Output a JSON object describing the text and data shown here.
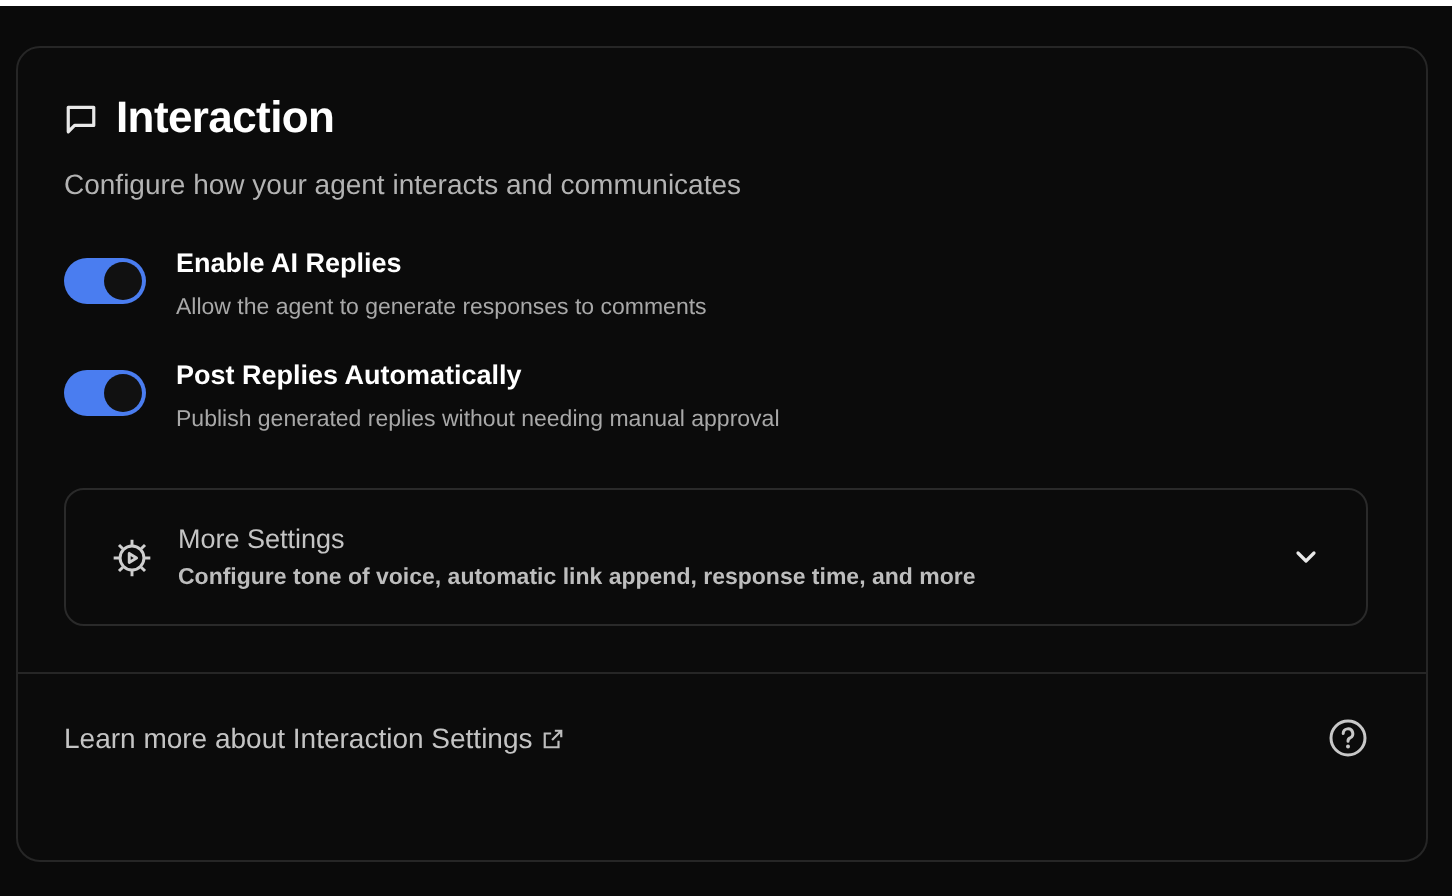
{
  "panel": {
    "title": "Interaction",
    "subtitle": "Configure how your agent interacts and communicates"
  },
  "toggles": [
    {
      "label": "Enable AI Replies",
      "description": "Allow the agent to generate responses to comments",
      "on": true
    },
    {
      "label": "Post Replies Automatically",
      "description": "Publish generated replies without needing manual approval",
      "on": true
    }
  ],
  "more_settings": {
    "title": "More Settings",
    "description": "Configure tone of voice, automatic link append, response time, and more",
    "expanded": false
  },
  "footer": {
    "link": "Learn more about Interaction Settings"
  }
}
